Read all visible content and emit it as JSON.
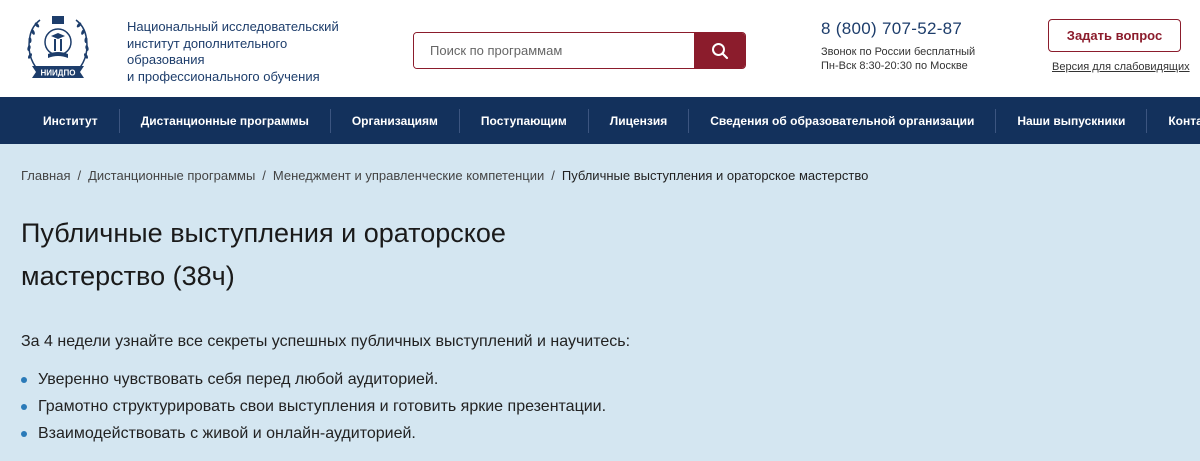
{
  "header": {
    "logo_text": "НИИДПО",
    "org_name": {
      "line1": "Национальный исследовательский",
      "line2": "институт дополнительного образования",
      "line3": "и профессионального обучения"
    },
    "search": {
      "placeholder": "Поиск по программам",
      "value": ""
    },
    "contact": {
      "phone": "8 (800) 707-52-87",
      "note_line1": "Звонок по России бесплатный",
      "note_line2": "Пн-Вск 8:30-20:30 по Москве"
    },
    "ask_button": "Задать вопрос",
    "accessible_version": "Версия для слабовидящих"
  },
  "nav": {
    "items": [
      "Институт",
      "Дистанционные программы",
      "Организациям",
      "Поступающим",
      "Лицензия",
      "Сведения об образовательной организации",
      "Наши выпускники",
      "Контакты"
    ]
  },
  "breadcrumb": {
    "items": [
      "Главная",
      "Дистанционные программы",
      "Менеджмент и управленческие компетенции",
      "Публичные выступления и ораторское мастерство"
    ],
    "separator": "/"
  },
  "page": {
    "title_line1": "Публичные выступления и ораторское",
    "title_line2": "мастерство (38ч)",
    "intro": "За 4 недели узнайте все секреты успешных публичных выступлений и научитесь:",
    "bullets": [
      "Уверенно чувствовать себя перед любой аудиторией.",
      "Грамотно структурировать свои выступления и готовить яркие презентации.",
      "Взаимодействовать с живой и онлайн-аудиторией."
    ]
  },
  "colors": {
    "brand_navy": "#13315c",
    "accent_burgundy": "#8b1c2c",
    "content_bg": "#d4e6f1",
    "bullet_blue": "#2a7ab8"
  },
  "icons": {
    "search": "search-icon",
    "logo": "institute-emblem-icon"
  }
}
